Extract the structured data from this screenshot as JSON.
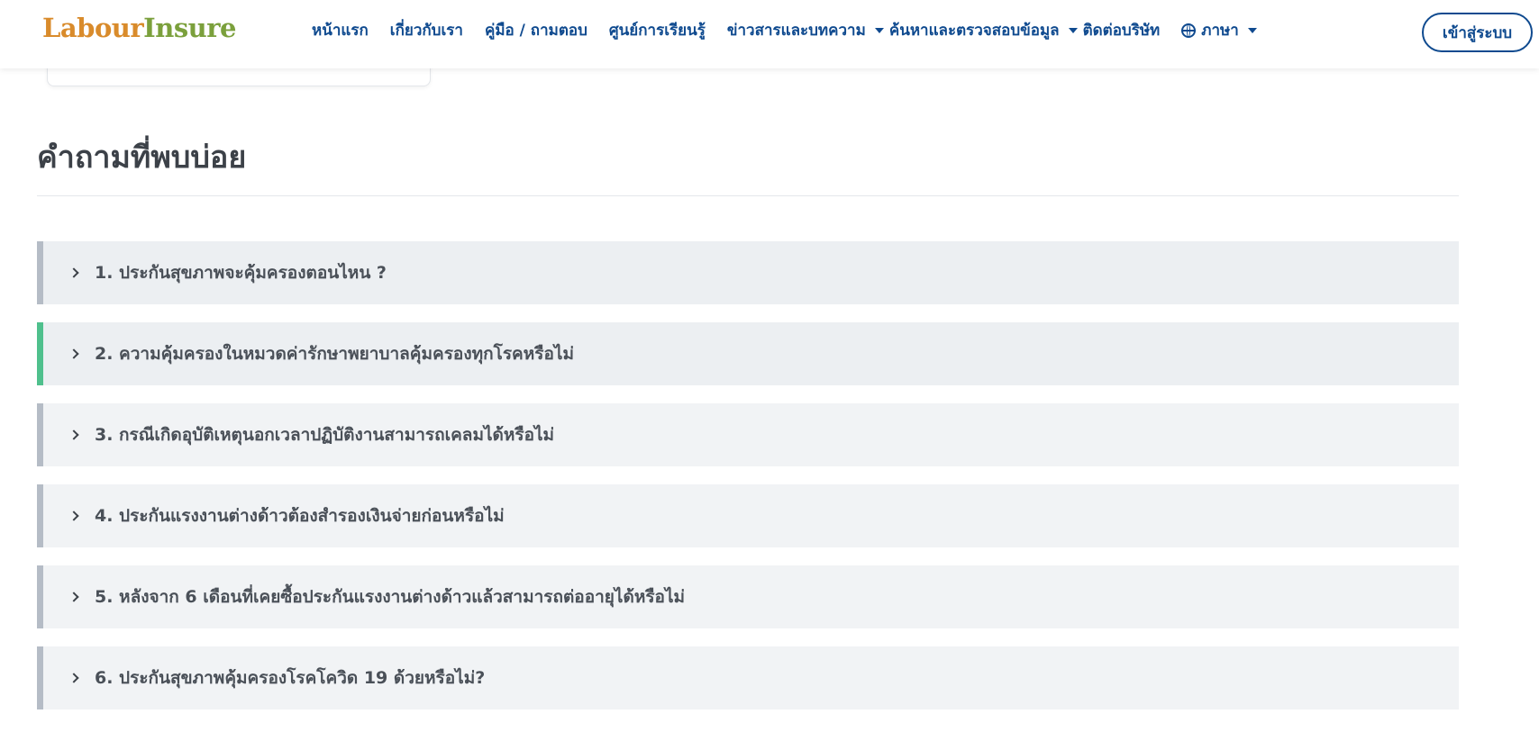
{
  "logo": {
    "part1": "Labour",
    "part2": "Insure"
  },
  "nav": {
    "items": [
      {
        "label": "หน้าแรก",
        "dropdown": false
      },
      {
        "label": "เกี่ยวกับเรา",
        "dropdown": false
      },
      {
        "label": "คู่มือ / ถามตอบ",
        "dropdown": false
      },
      {
        "label": "ศูนย์การเรียนรู้",
        "dropdown": false
      },
      {
        "label": "ข่าวสารและบทความ",
        "dropdown": true
      },
      {
        "label": "ค้นหาและตรวจสอบข้อมูล",
        "dropdown": true
      },
      {
        "label": "ติดต่อบริษัท",
        "dropdown": false
      }
    ],
    "language": {
      "label": "ภาษา",
      "icon": "globe-icon"
    }
  },
  "login": {
    "label": "เข้าสู่ระบบ"
  },
  "faq": {
    "title": "คำถามที่พบบ่อย",
    "items": [
      {
        "question": "1. ประกันสุขภาพจะคุ้มครองตอนไหน ?"
      },
      {
        "question": "2. ความคุ้มครองในหมวดค่ารักษาพยาบาลคุ้มครองทุกโรคหรือไม่"
      },
      {
        "question": "3. กรณีเกิดอุบัติเหตุนอกเวลาปฏิบัติงานสามารถเคลมได้หรือไม่"
      },
      {
        "question": "4. ประกันแรงงานต่างด้าวต้องสำรองเงินจ่ายก่อนหรือไม่"
      },
      {
        "question": "5. หลังจาก 6 เดือนที่เคยซื้อประกันแรงงานต่างด้าวแล้วสามารถต่ออายุได้หรือไม่"
      },
      {
        "question": "6. ประกันสุขภาพคุ้มครองโรคโควิด 19 ด้วยหรือไม่?"
      }
    ]
  },
  "colors": {
    "brand_blue": "#0f4a8f",
    "logo_orange": "#d98b2b",
    "logo_green": "#7ba03c",
    "active_accent": "#4fc08d"
  }
}
